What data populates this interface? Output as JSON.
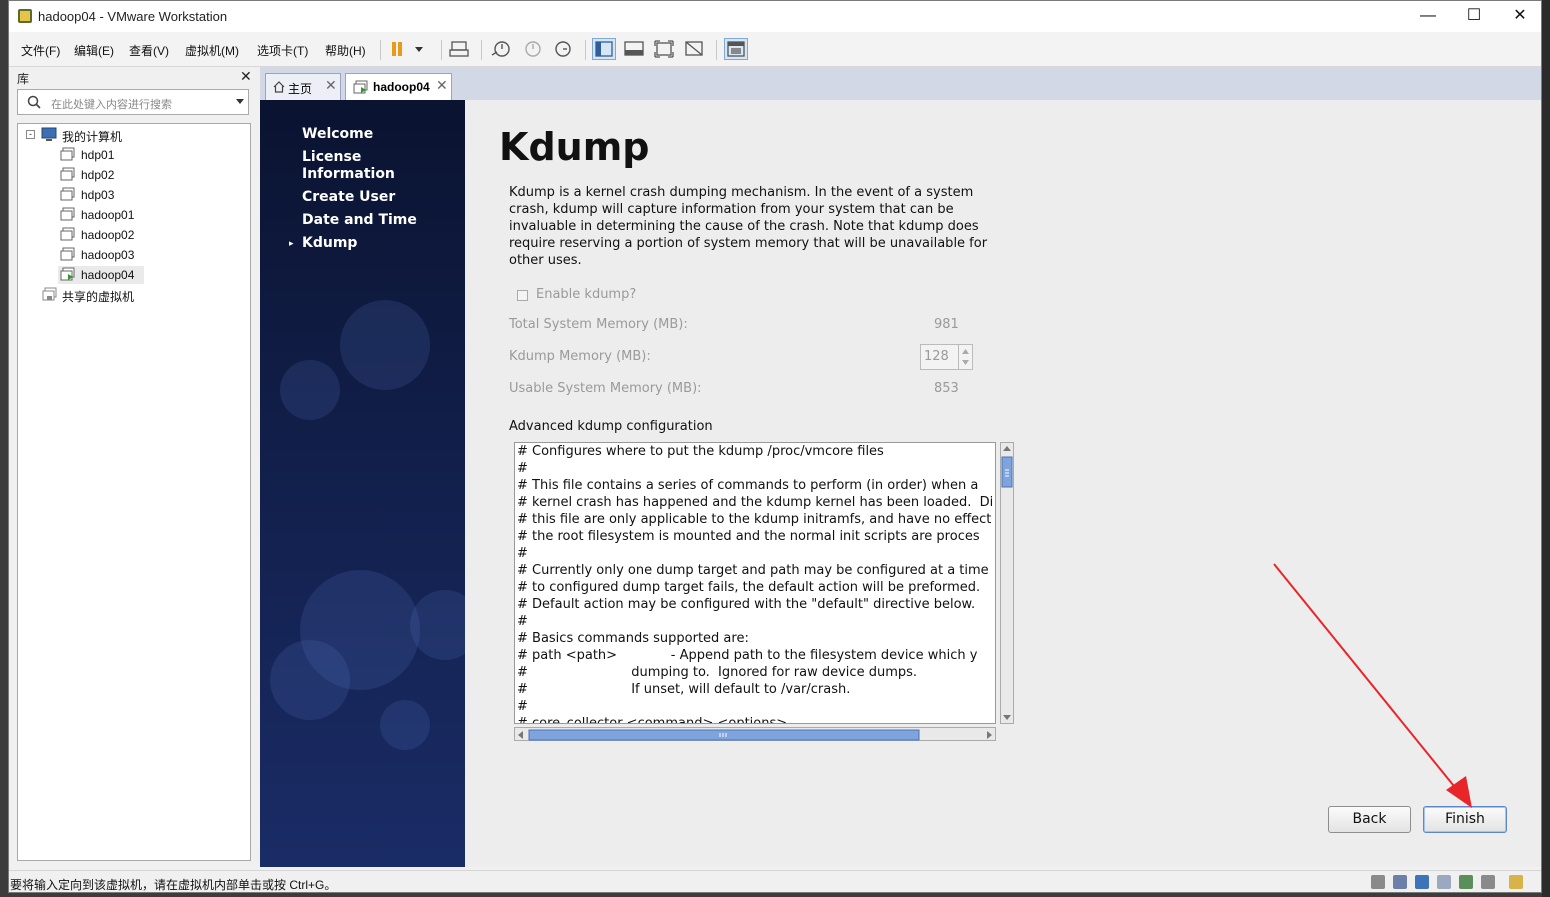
{
  "window": {
    "title": "hadoop04 - VMware Workstation"
  },
  "menu": [
    "文件(F)",
    "编辑(E)",
    "查看(V)",
    "虚拟机(M)",
    "选项卡(T)",
    "帮助(H)"
  ],
  "library": {
    "title": "库",
    "search_placeholder": "在此处键入内容进行搜索",
    "root": "我的计算机",
    "vms": [
      "hdp01",
      "hdp02",
      "hdp03",
      "hadoop01",
      "hadoop02",
      "hadoop03",
      "hadoop04"
    ],
    "selected_vm": "hadoop04",
    "shared": "共享的虚拟机"
  },
  "tabs": [
    {
      "label": "主页",
      "active": false
    },
    {
      "label": "hadoop04",
      "active": true
    }
  ],
  "installer": {
    "steps": [
      "Welcome",
      "License\nInformation",
      "Create User",
      "Date and Time",
      "Kdump"
    ],
    "current_step": "Kdump",
    "heading": "Kdump",
    "description": "Kdump is a kernel crash dumping mechanism. In the event of a system crash, kdump will capture information from your system that can be invaluable in determining the cause of the crash. Note that kdump does require reserving a portion of system memory that will be unavailable for other uses.",
    "enable_label": "Enable kdump?",
    "enable_checked": false,
    "total_memory_label": "Total System Memory (MB):",
    "total_memory_value": "981",
    "kdump_memory_label": "Kdump Memory (MB):",
    "kdump_memory_value": "128",
    "usable_memory_label": "Usable System Memory (MB):",
    "usable_memory_value": "853",
    "advanced_label": "Advanced kdump configuration",
    "config_text": "# Configures where to put the kdump /proc/vmcore files\n#\n# This file contains a series of commands to perform (in order) when a\n# kernel crash has happened and the kdump kernel has been loaded.  Di\n# this file are only applicable to the kdump initramfs, and have no effect\n# the root filesystem is mounted and the normal init scripts are proces\n#\n# Currently only one dump target and path may be configured at a time\n# to configured dump target fails, the default action will be preformed.\n# Default action may be configured with the \"default\" directive below.\n#\n# Basics commands supported are:\n# path <path>             - Append path to the filesystem device which y\n#                         dumping to.  Ignored for raw device dumps.\n#                         If unset, will default to /var/crash.\n#\n# core_collector <command> <options>",
    "back_label": "Back",
    "finish_label": "Finish"
  },
  "status_bar": {
    "text": "要将输入定向到该虚拟机，请在虚拟机内部单击或按 Ctrl+G。"
  },
  "colors": {
    "annotation_arrow": "#e8262a",
    "side_panel": "#101c45"
  }
}
